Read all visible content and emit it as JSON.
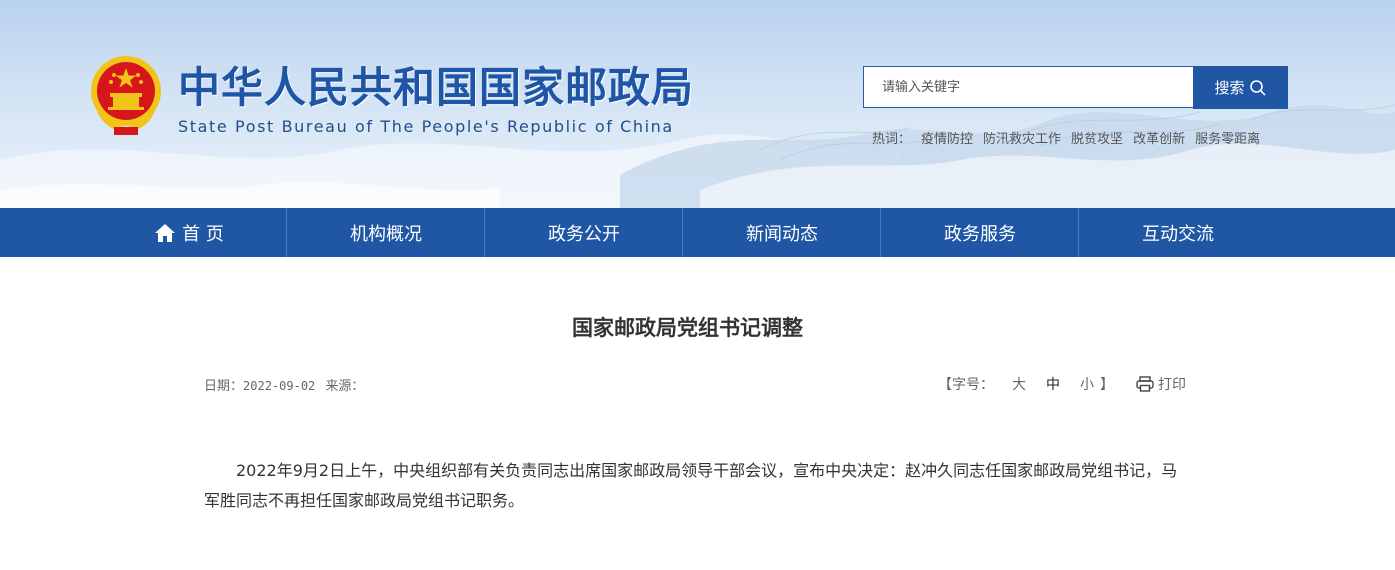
{
  "header": {
    "site_title": "中华人民共和国国家邮政局",
    "site_subtitle": "State Post Bureau of The People's Republic of China",
    "search": {
      "placeholder": "请输入关键字",
      "button_label": "搜索"
    },
    "hot_words": {
      "label": "热词：",
      "items": [
        "疫情防控",
        "防汛救灾工作",
        "脱贫攻坚",
        "改革创新",
        "服务零距离"
      ]
    }
  },
  "nav": {
    "items": [
      {
        "label": "首 页",
        "icon": "home-icon"
      },
      {
        "label": "机构概况"
      },
      {
        "label": "政务公开"
      },
      {
        "label": "新闻动态"
      },
      {
        "label": "政务服务"
      },
      {
        "label": "互动交流"
      }
    ]
  },
  "article": {
    "title": "国家邮政局党组书记调整",
    "date_label": "日期：",
    "date": "2022-09-02",
    "source_label": "来源：",
    "font_size": {
      "prefix": "【字号：",
      "large": "大",
      "medium": "中",
      "small": "小",
      "suffix": "】",
      "selected": "中"
    },
    "print_label": "打印",
    "body": "2022年9月2日上午，中央组织部有关负责同志出席国家邮政局领导干部会议，宣布中央决定：赵冲久同志任国家邮政局党组书记，马军胜同志不再担任国家邮政局党组书记职务。"
  },
  "colors": {
    "nav_bg": "#1f57a5",
    "title_blue": "#1e55a6",
    "emblem_red": "#d7161c",
    "emblem_gold": "#f0c419"
  }
}
